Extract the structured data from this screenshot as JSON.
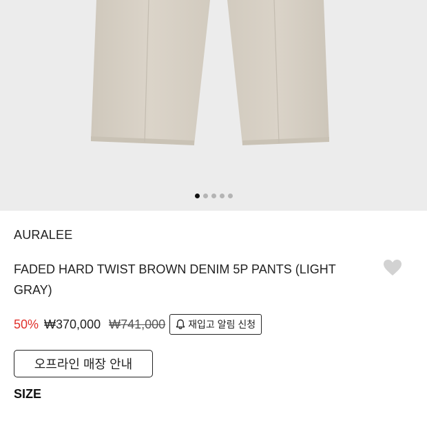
{
  "gallery": {
    "image": "pants-photo",
    "slide_count": 5,
    "active_slide": 1
  },
  "product": {
    "brand": "AURALEE",
    "name": "FADED HARD TWIST BROWN DENIM 5P PANTS (LIGHT GRAY)",
    "wishlist_icon": "heart-icon"
  },
  "price": {
    "discount": "50%",
    "sale": "₩370,000",
    "original": "₩741,000",
    "restock_label": "재입고 알림 신청",
    "restock_icon": "bell-icon"
  },
  "actions": {
    "offline_store_label": "오프라인 매장 안내"
  },
  "options": {
    "size_label": "SIZE"
  },
  "colors": {
    "discount": "#e0302a",
    "pants": "#d6cfc4",
    "background": "#ececec"
  }
}
